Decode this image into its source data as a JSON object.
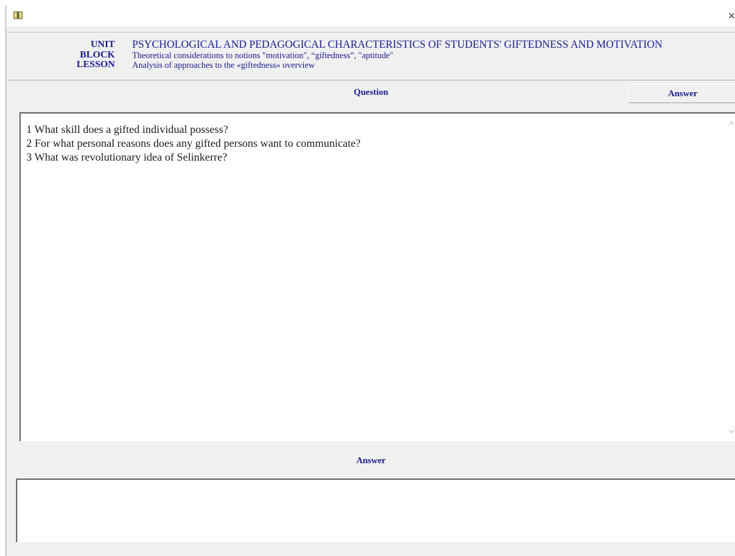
{
  "window": {
    "close_glyph": "×",
    "app_icon": "book-icon"
  },
  "header": {
    "unit_label": "UNIT",
    "unit_value": "PSYCHOLOGICAL AND PEDAGOGICAL CHARACTERISTICS OF STUDENTS' GIFTEDNESS AND MOTIVATION",
    "block_label": "BLOCK",
    "block_value": "Theoretical considerations to notions \"motivation\", “giftedness”, \"aptitude\"",
    "lesson_label": "LESSON",
    "lesson_value": "Analysis of approaches to the «giftedness» overview"
  },
  "question_section": {
    "label": "Question",
    "answer_tab_label": "Answer",
    "questions": [
      "1 What skill does a gifted individual possess?",
      "2 For what personal reasons does any gifted persons want to communicate?",
      "3 What was revolutionary idea of Selinkerre?"
    ]
  },
  "answer_section": {
    "label": "Answer",
    "value": ""
  },
  "colors": {
    "accent": "#1a1a8c",
    "panel": "#f0f0f0",
    "text": "#1a1a1a"
  }
}
